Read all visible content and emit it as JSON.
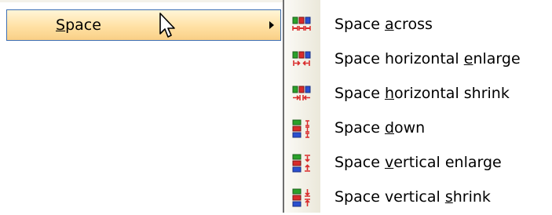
{
  "parent_menu": {
    "item_label": "Space",
    "mnemonic_index": 0
  },
  "submenu": {
    "items": [
      {
        "label": "Space across",
        "mnemonic_index": 6,
        "icon": "space-across-icon"
      },
      {
        "label": "Space horizontal enlarge",
        "mnemonic_index": 17,
        "icon": "horizontal-enlarge-icon"
      },
      {
        "label": "Space horizontal shrink",
        "mnemonic_index": 6,
        "icon": "horizontal-shrink-icon"
      },
      {
        "label": "Space down",
        "mnemonic_index": 6,
        "icon": "space-down-icon"
      },
      {
        "label": "Space vertical enlarge",
        "mnemonic_index": 6,
        "icon": "vertical-enlarge-icon"
      },
      {
        "label": "Space vertical shrink",
        "mnemonic_index": 15,
        "icon": "vertical-shrink-icon"
      }
    ]
  },
  "colors": {
    "highlight_border": "#3c6fb4",
    "highlight_fill": "#ffe1a4",
    "icon_red": "#d92b2b",
    "icon_green": "#2aa12a",
    "icon_blue": "#2a4fd0"
  }
}
